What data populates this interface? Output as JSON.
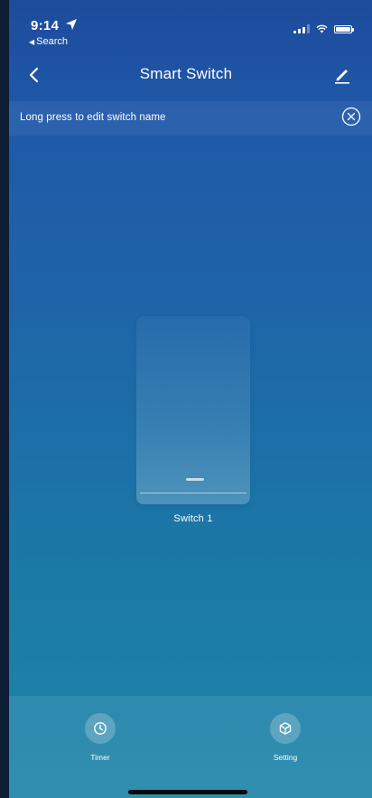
{
  "status_bar": {
    "time": "9:14",
    "back_app": "Search"
  },
  "nav": {
    "title": "Smart Switch"
  },
  "hint": {
    "text": "Long press to edit switch name"
  },
  "switches": [
    {
      "label": "Switch 1"
    }
  ],
  "actions": {
    "timer_label": "Timer",
    "setting_label": "Setting"
  },
  "colors": {
    "background_top": "#1e4b9c",
    "background_bottom": "#1f86aa",
    "text": "#ffffff"
  },
  "icons": {
    "back": "chevron-left-icon",
    "edit": "pencil-icon",
    "close": "close-circle-icon",
    "timer": "clock-icon",
    "setting": "cube-icon"
  }
}
